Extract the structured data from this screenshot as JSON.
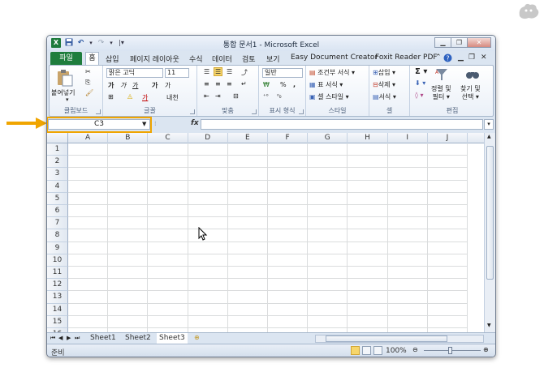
{
  "window": {
    "title": "통합 문서1 - Microsoft Excel",
    "app_icon": "X",
    "controls": [
      "minimize-icon",
      "restore-icon",
      "close-icon"
    ]
  },
  "quick_access": {
    "save": "💾",
    "undo": "↶",
    "redo": "↷",
    "customize": "▾"
  },
  "tabs": {
    "file": "파일",
    "home": "홈",
    "insert": "삽입",
    "page_layout": "페이지 레이아웃",
    "formulas": "수식",
    "data": "데이터",
    "review": "검토",
    "view": "보기",
    "easy_doc": "Easy Document Creator",
    "foxit": "Foxit Reader PDF"
  },
  "ribbon": {
    "clipboard": {
      "label": "클립보드",
      "paste": "붙여넣기"
    },
    "font": {
      "label": "글꼴",
      "font_name": "맑은 고딕",
      "font_size": "11",
      "bold": "가",
      "italic": "가",
      "underline": "가",
      "grow": "가",
      "shrink": "가",
      "color": "가",
      "phonetic": "내천"
    },
    "alignment": {
      "label": "맞춤"
    },
    "number": {
      "label": "표시 형식",
      "format": "일반",
      "percent": "%",
      "comma": ","
    },
    "styles": {
      "label": "스타일",
      "conditional": "조건부 서식",
      "table": "표 서식",
      "cell_styles": "셀 스타일"
    },
    "cells": {
      "label": "셀",
      "insert": "삽입",
      "delete": "삭제",
      "format": "서식"
    },
    "editing": {
      "label": "편집",
      "sort_line1": "정렬 및",
      "sort_line2": "필터",
      "find_line1": "찾기 및",
      "find_line2": "선택"
    }
  },
  "formula_bar": {
    "name_box": "C3",
    "fx": "fx",
    "formula": ""
  },
  "grid": {
    "columns": [
      "A",
      "B",
      "C",
      "D",
      "E",
      "F",
      "G",
      "H",
      "I",
      "J"
    ],
    "rows": [
      "1",
      "2",
      "3",
      "4",
      "5",
      "6",
      "7",
      "8",
      "9",
      "10",
      "11",
      "12",
      "13",
      "14",
      "15",
      "16"
    ]
  },
  "sheets": [
    "Sheet1",
    "Sheet2",
    "Sheet3"
  ],
  "status": {
    "ready": "준비",
    "zoom": "100%"
  },
  "colors": {
    "accent_green": "#1f7d3d",
    "highlight_orange": "#f0a500",
    "ribbon_bg": "#dbe5f1"
  }
}
